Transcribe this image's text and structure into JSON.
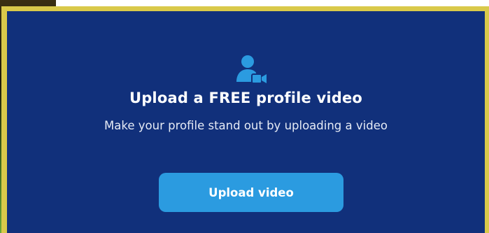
{
  "upload_card": {
    "icon": "user-video-camera-icon",
    "title": "Upload a FREE profile video",
    "subtitle": "Make your profile stand out by uploading a video",
    "button_label": "Upload video"
  },
  "colors": {
    "panel_background": "#11307b",
    "frame_border": "#d9c94a",
    "button_background": "#2b9be0",
    "icon_color": "#2b9be0",
    "title_text": "#ffffff"
  }
}
